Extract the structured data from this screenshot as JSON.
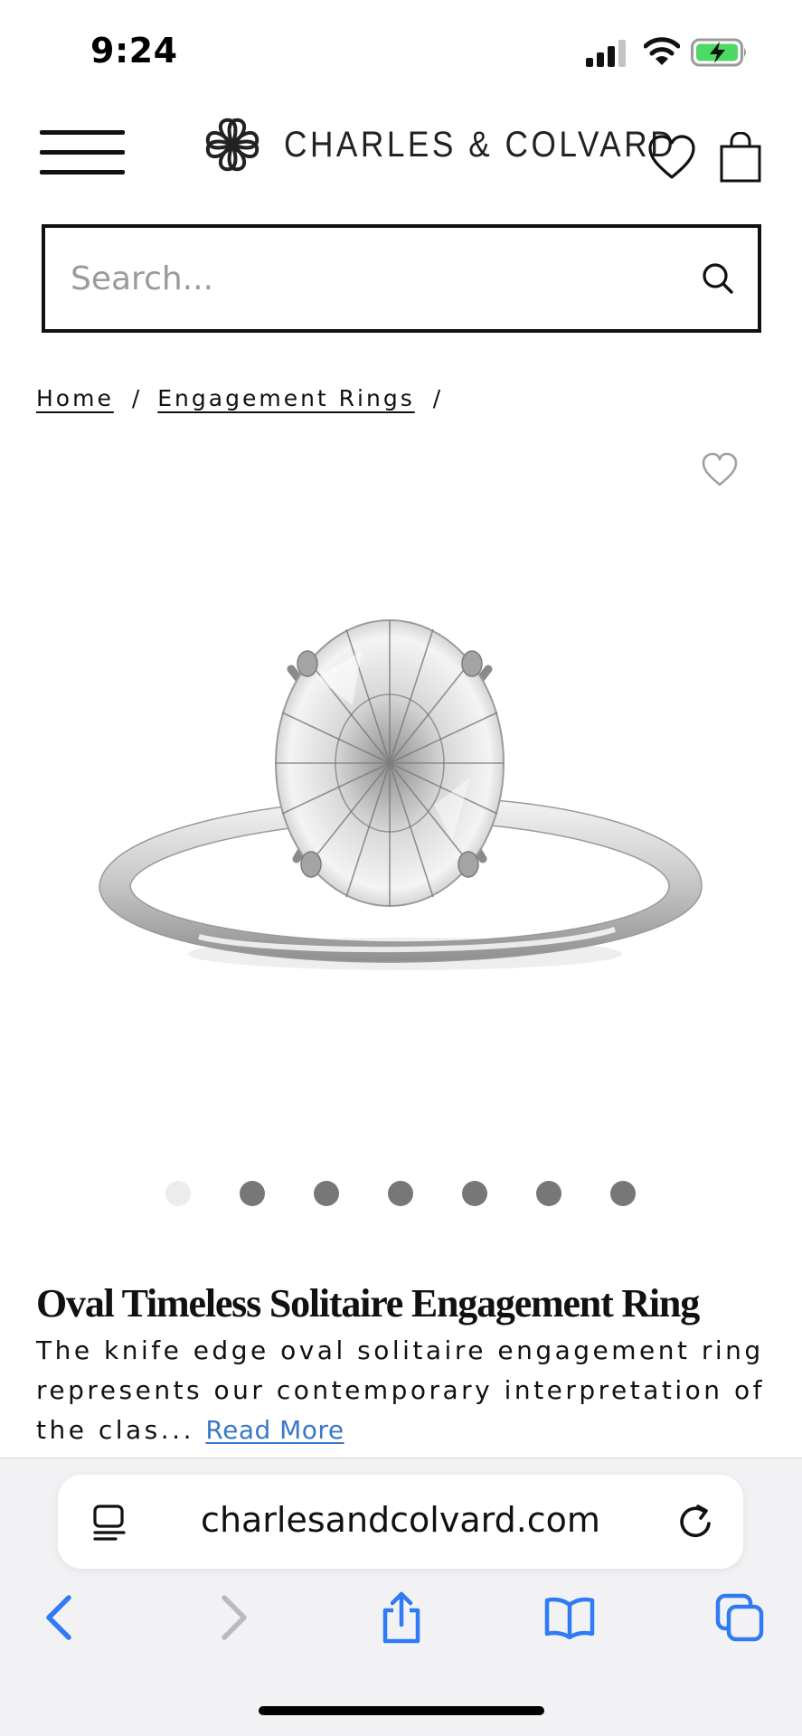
{
  "status_bar": {
    "time": "9:24"
  },
  "header": {
    "brand_name": "CHARLES & COLVARD",
    "icons": [
      "menu-icon",
      "logo-icon",
      "heart-icon",
      "shopping-bag-icon"
    ]
  },
  "search": {
    "placeholder": "Search...",
    "value": ""
  },
  "breadcrumb": {
    "items": [
      "Home",
      "Engagement Rings"
    ],
    "separator": "/"
  },
  "gallery": {
    "image_alt": "Oval moissanite solitaire ring",
    "slide_count": 7,
    "active_slide": 1
  },
  "product": {
    "title": "Oval Timeless Solitaire Engagement Ring",
    "description": "The knife edge oval solitaire engagement ring represents our contemporary interpretation of the clas...",
    "read_more": "Read More"
  },
  "browser": {
    "url": "charlesandcolvard.com",
    "toolbar_icons": [
      "back-icon",
      "forward-icon",
      "share-icon",
      "bookmarks-icon",
      "tabs-icon"
    ]
  },
  "colors": {
    "link": "#3a78c9",
    "browser_accent": "#2f7bf5",
    "browser_disabled": "#b9b9be",
    "text": "#111111",
    "dot_inactive": "#777777",
    "dot_active": "#ececec",
    "battery_fill": "#4cd964"
  }
}
